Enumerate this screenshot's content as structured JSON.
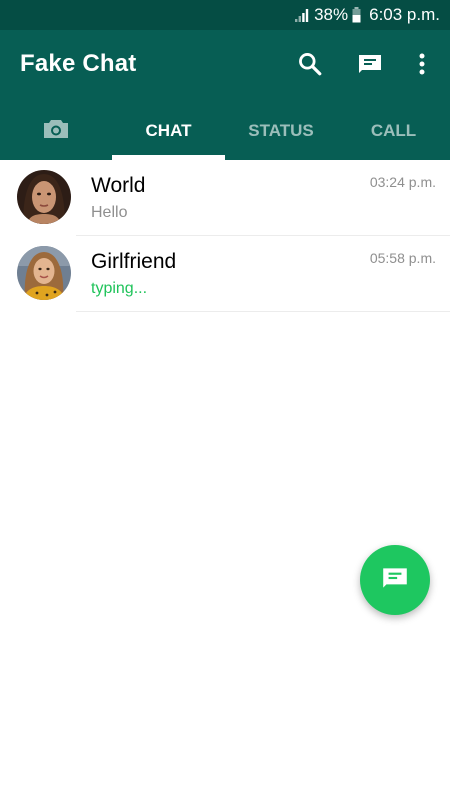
{
  "status_bar": {
    "battery_percent": "38%",
    "time": "6:03 p.m.",
    "icons": [
      "signal-icon",
      "battery-icon"
    ]
  },
  "app_bar": {
    "title": "Fake Chat",
    "actions": [
      "search-icon",
      "new-chat-icon",
      "more-options-icon"
    ]
  },
  "tabs": {
    "camera_icon": "camera-icon",
    "items": [
      {
        "label": "CHAT",
        "active": true
      },
      {
        "label": "STATUS",
        "active": false
      },
      {
        "label": "CALL",
        "active": false
      }
    ]
  },
  "chats": [
    {
      "name": "World",
      "message": "Hello",
      "time": "03:24 p.m."
    },
    {
      "name": "Girlfriend",
      "message": "typing...",
      "time": "05:58 p.m."
    }
  ],
  "fab": {
    "icon": "new-chat-icon"
  },
  "colors": {
    "status_bar": "#054d44",
    "app_bar": "#075e54",
    "fab": "#1ec760",
    "typing": "#1fc35a",
    "secondary_text": "#8f8f8f"
  }
}
